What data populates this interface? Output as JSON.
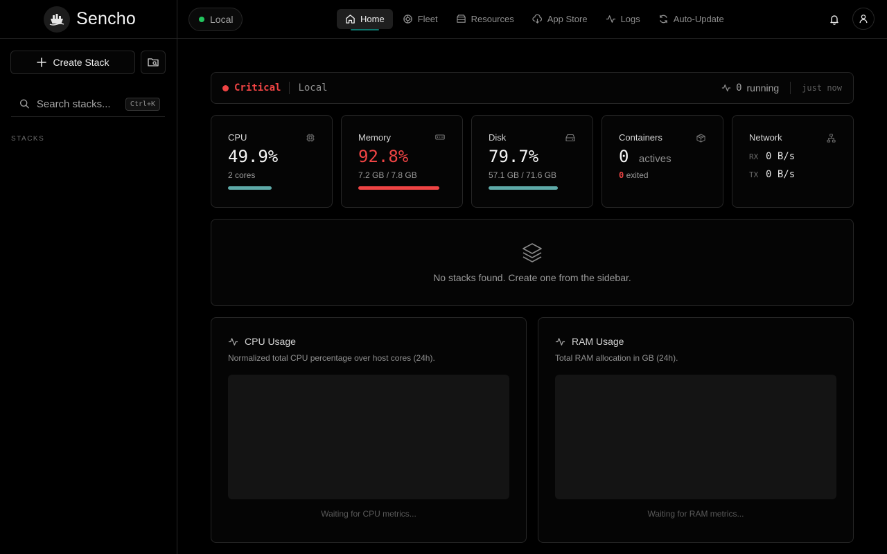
{
  "brand": {
    "name": "Sencho"
  },
  "sidebar": {
    "create_label": "Create Stack",
    "search_placeholder": "Search stacks...",
    "search_shortcut": "Ctrl+K",
    "stacks_heading": "STACKS"
  },
  "topbar": {
    "node_name": "Local",
    "nav": [
      {
        "label": "Home",
        "icon": "home-icon",
        "active": true
      },
      {
        "label": "Fleet",
        "icon": "fleet-icon"
      },
      {
        "label": "Resources",
        "icon": "resources-icon"
      },
      {
        "label": "App Store",
        "icon": "cloud-download-icon"
      },
      {
        "label": "Logs",
        "icon": "activity-icon"
      },
      {
        "label": "Auto-Update",
        "icon": "refresh-icon"
      }
    ]
  },
  "status": {
    "level": "Critical",
    "node": "Local",
    "running_count": "0",
    "running_label": "running",
    "updated": "just now"
  },
  "cards": {
    "cpu": {
      "title": "CPU",
      "value": "49.9%",
      "sub": "2 cores",
      "percent": 49.9
    },
    "memory": {
      "title": "Memory",
      "value": "92.8%",
      "sub": "7.2 GB / 7.8 GB",
      "percent": 92.8
    },
    "disk": {
      "title": "Disk",
      "value": "79.7%",
      "sub": "57.1 GB / 71.6 GB",
      "percent": 79.7
    },
    "containers": {
      "title": "Containers",
      "value": "0",
      "actives_label": "actives",
      "exited_count": "0",
      "exited_label": "exited"
    },
    "network": {
      "title": "Network",
      "rx_label": "RX",
      "rx_value": "0 B/s",
      "tx_label": "TX",
      "tx_value": "0 B/s"
    }
  },
  "empty_state": {
    "text": "No stacks found. Create one from the sidebar."
  },
  "charts": {
    "cpu": {
      "title": "CPU Usage",
      "desc": "Normalized total CPU percentage over host cores (24h).",
      "waiting": "Waiting for CPU metrics..."
    },
    "ram": {
      "title": "RAM Usage",
      "desc": "Total RAM allocation in GB (24h).",
      "waiting": "Waiting for RAM metrics..."
    }
  },
  "colors": {
    "accent": "#5eaaa8",
    "critical": "#ef4444",
    "online": "#22c55e"
  }
}
